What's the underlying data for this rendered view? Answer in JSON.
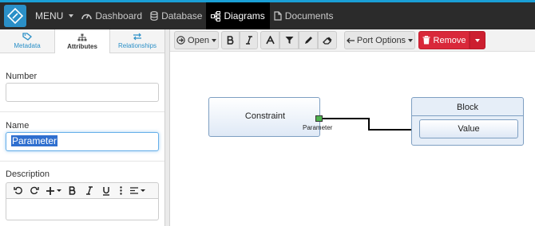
{
  "topnav": {
    "menu_label": "MENU",
    "items": [
      {
        "label": "Dashboard",
        "icon": "dashboard-icon"
      },
      {
        "label": "Database",
        "icon": "database-icon"
      },
      {
        "label": "Diagrams",
        "icon": "diagram-icon",
        "active": true
      },
      {
        "label": "Documents",
        "icon": "document-icon"
      }
    ],
    "accent_color": "#1a9fd6"
  },
  "left_panel": {
    "tabs": [
      {
        "label": "Metadata",
        "icon": "tag-icon"
      },
      {
        "label": "Attributes",
        "icon": "sitemap-icon",
        "active": true
      },
      {
        "label": "Relationships",
        "icon": "exchange-icon"
      }
    ],
    "number": {
      "label": "Number",
      "value": ""
    },
    "name": {
      "label": "Name",
      "value": "Parameter"
    },
    "description": {
      "label": "Description",
      "value": ""
    }
  },
  "toolbar": {
    "open_label": "Open",
    "port_options_label": "Port Options",
    "remove_label": "Remove",
    "remove_color": "#d9283a"
  },
  "canvas": {
    "constraint": {
      "title": "Constraint",
      "port_label": "Parameter"
    },
    "block": {
      "title": "Block",
      "value_label": "Value"
    },
    "port_color": "#4fb34f"
  }
}
